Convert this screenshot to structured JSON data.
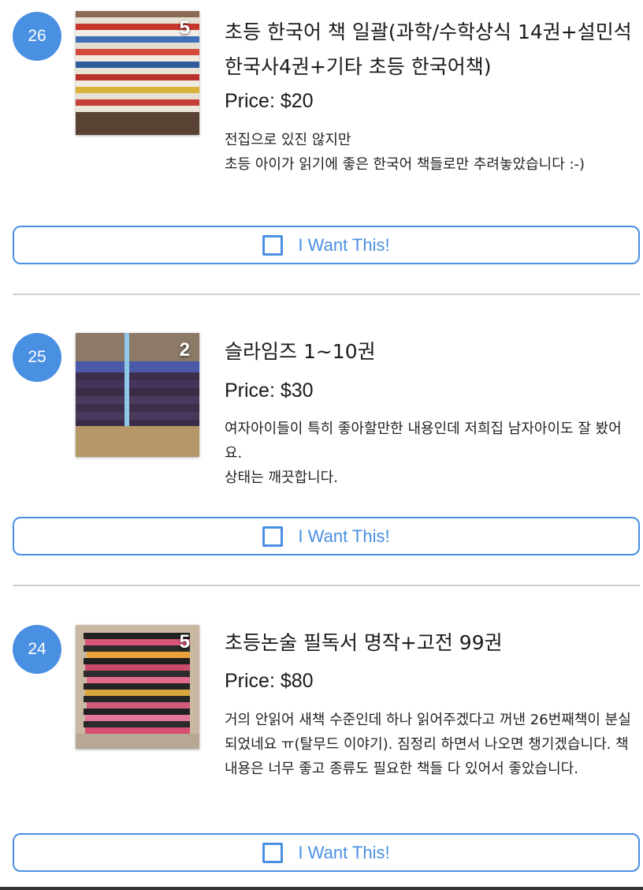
{
  "listings": [
    {
      "number": "26",
      "photo_count": "5",
      "title": "초등 한국어 책 일괄(과학/수학상식 14권+설민석한국사4권+기타 초등 한국어책)",
      "price": "Price: $20",
      "description": [
        "전집으로 있진 않지만",
        "초등 아이가 읽기에 좋은 한국어 책들로만 추려놓았습니다 :-)"
      ],
      "button_label": "I Want This!"
    },
    {
      "number": "25",
      "photo_count": "2",
      "title": "슬라임즈 1~10권",
      "price": "Price: $30",
      "description": [
        "여자아이들이 특히 좋아할만한 내용인데 저희집 남자아이도 잘 봤어요.",
        "상태는 깨끗합니다."
      ],
      "button_label": "I Want This!"
    },
    {
      "number": "24",
      "photo_count": "5",
      "title": "초등논술 필독서 명작+고전 99권",
      "price": "Price: $80",
      "description": [
        "거의 안읽어 새책 수준인데 하나 읽어주겠다고 꺼낸 26번째책이 분실되었네요 ㅠ(탈무드 이야기).  짐정리 하면서 나오면 챙기겠습니다. 책 내용은 너무 좋고 종류도 필요한 책들 다 있어서 좋았습니다."
      ],
      "button_label": "I Want This!"
    }
  ],
  "colors": {
    "accent": "#4a90e2",
    "divider": "#cfcfcf"
  }
}
